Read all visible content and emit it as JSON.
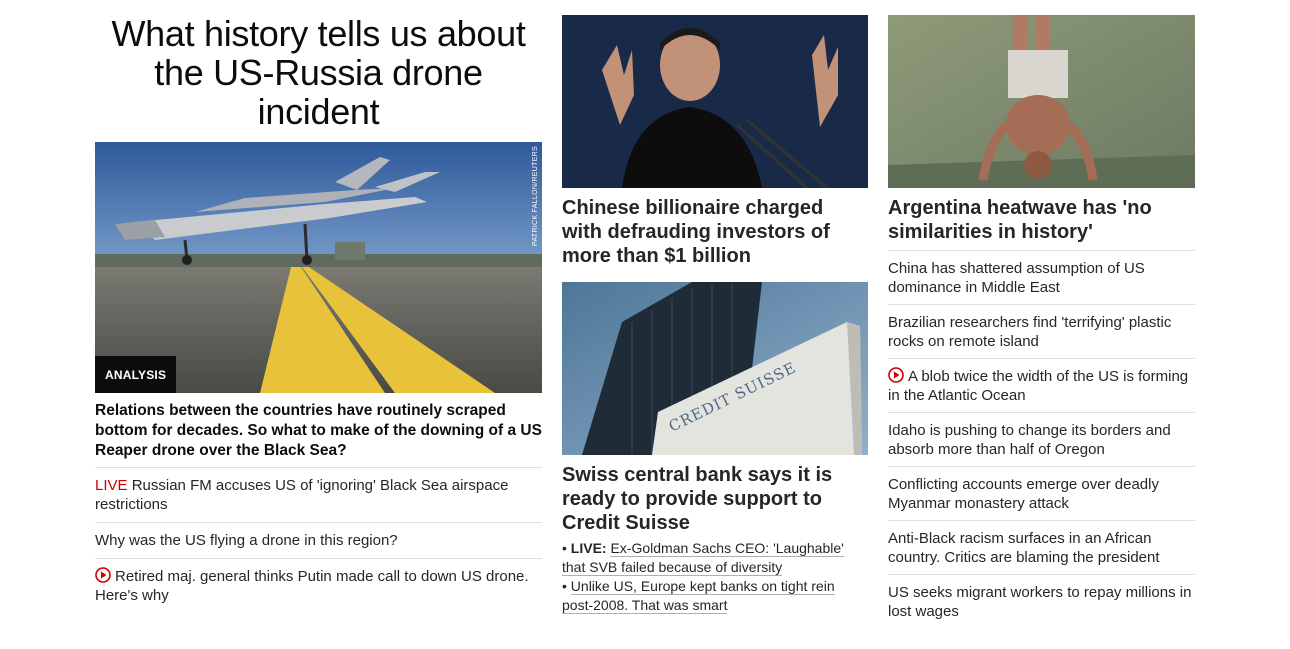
{
  "hero": {
    "title": "What history tells us about the US-Russia drone incident",
    "badge": "ANALYSIS",
    "credit": "PATRICK FALLON/REUTERS",
    "summary": "Relations between the countries have routinely scraped bottom for decades. So what to make of the downing of a US Reaper drone over the Black Sea?",
    "related": [
      {
        "prefix": "LIVE",
        "text": "Russian FM accuses US of 'ignoring' Black Sea airspace restrictions"
      },
      {
        "text": "Why was the US flying a drone in this region?"
      },
      {
        "video": true,
        "text": "Retired maj. general thinks Putin made call to down US drone. Here's why"
      }
    ]
  },
  "middle": {
    "story1": {
      "headline": "Chinese billionaire charged with defrauding investors of more than $1 billion"
    },
    "story2": {
      "headline": "Swiss central bank says it is ready to provide support to Credit Suisse",
      "logo_text": "CREDIT SUISSE",
      "bullets": [
        {
          "prefix": "LIVE:",
          "text": "Ex-Goldman Sachs CEO: 'Laughable' that SVB failed because of diversity"
        },
        {
          "text": "Unlike US, Europe kept banks on tight rein post-2008. That was smart"
        }
      ]
    }
  },
  "right": {
    "headline": "Argentina heatwave has 'no similarities in history'",
    "list": [
      {
        "text": "China has shattered assumption of US dominance in Middle East"
      },
      {
        "text": "Brazilian researchers find 'terrifying' plastic rocks on remote island"
      },
      {
        "video": true,
        "text": "A blob twice the width of the US is forming in the Atlantic Ocean"
      },
      {
        "text": "Idaho is pushing to change its borders and absorb more than half of Oregon"
      },
      {
        "text": "Conflicting accounts emerge over deadly Myanmar monastery attack"
      },
      {
        "text": "Anti-Black racism surfaces in an African country. Critics are blaming the president"
      },
      {
        "text": "US seeks migrant workers to repay millions in lost wages"
      }
    ]
  },
  "colors": {
    "live": "#cc0000",
    "badge_bg": "#0c0c0c",
    "play_icon": "#cc0000"
  }
}
